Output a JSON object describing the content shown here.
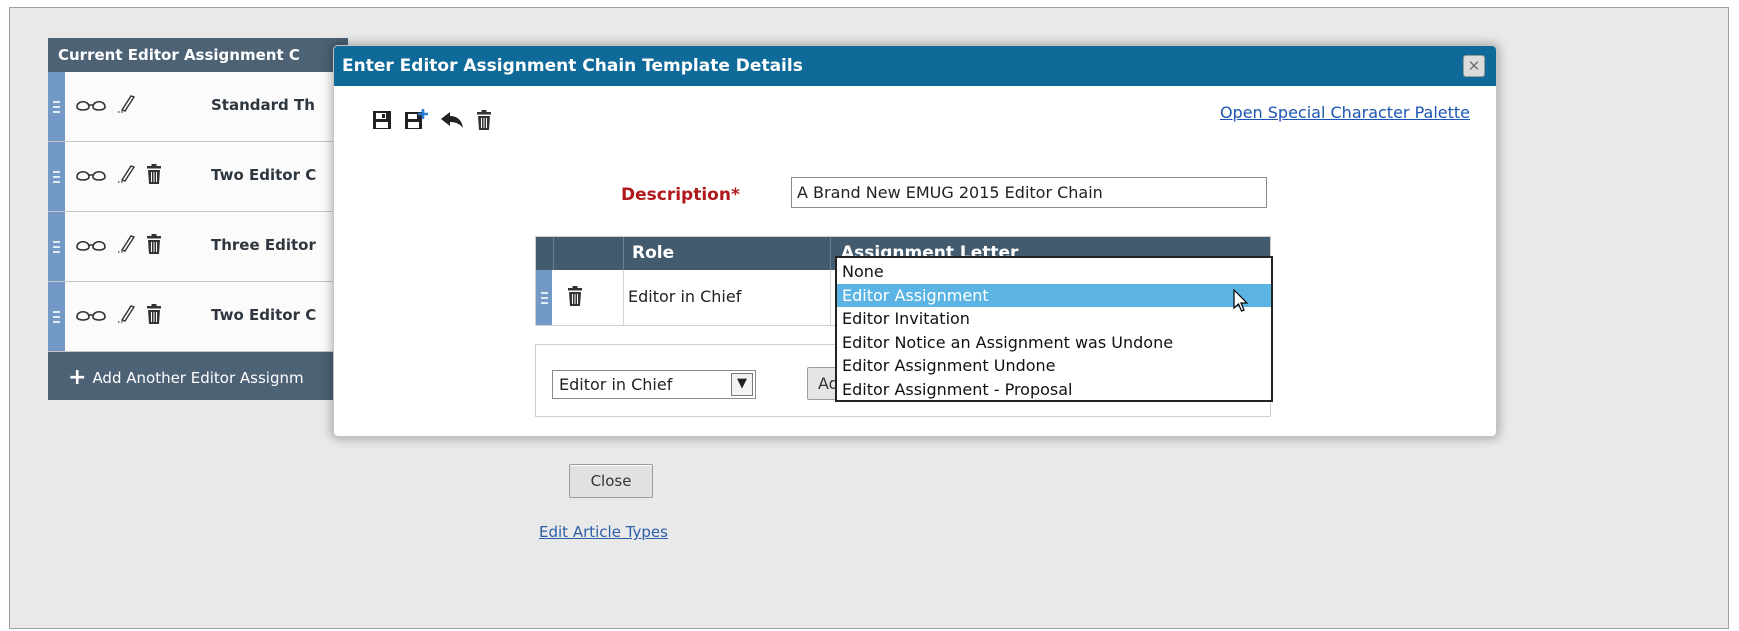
{
  "background": {
    "header": "Current Editor Assignment C",
    "rows": [
      {
        "name": "Standard Th",
        "delete": false
      },
      {
        "name": "Two Editor C",
        "delete": true
      },
      {
        "name": "Three Editor",
        "delete": true
      },
      {
        "name": "Two Editor C",
        "delete": true
      }
    ],
    "add_label": "Add Another Editor Assignm",
    "close_label": "Close",
    "edit_article_types": "Edit Article Types"
  },
  "modal": {
    "title": "Enter Editor Assignment Chain Template Details",
    "close_icon": "close-icon",
    "toolbar_icons": [
      "save-icon",
      "save-add-icon",
      "back-arrow-icon",
      "trash-icon"
    ],
    "palette_link": "Open Special Character Palette",
    "description_label": "Description*",
    "description_value": "A Brand New EMUG 2015 Editor Chain",
    "table": {
      "columns": [
        "Role",
        "Assignment Letter"
      ],
      "rows": [
        {
          "role": "Editor in Chief"
        }
      ]
    },
    "add": {
      "role_selected": "Editor in Chief",
      "button_label": "Ad"
    }
  },
  "dropdown": {
    "options": [
      "None",
      "Editor Assignment",
      "Editor Invitation",
      "Editor Notice an Assignment was Undone",
      "Editor Assignment Undone",
      "Editor Assignment - Proposal"
    ],
    "selected": "Editor Assignment"
  },
  "colors": {
    "title_bar": "#0f6a99",
    "list_header": "#4d6275",
    "table_header": "#435b6f",
    "grip": "#7399c6",
    "required_label": "#b0181b",
    "selected_option": "#5bb4e3",
    "link": "#1a55b5"
  }
}
